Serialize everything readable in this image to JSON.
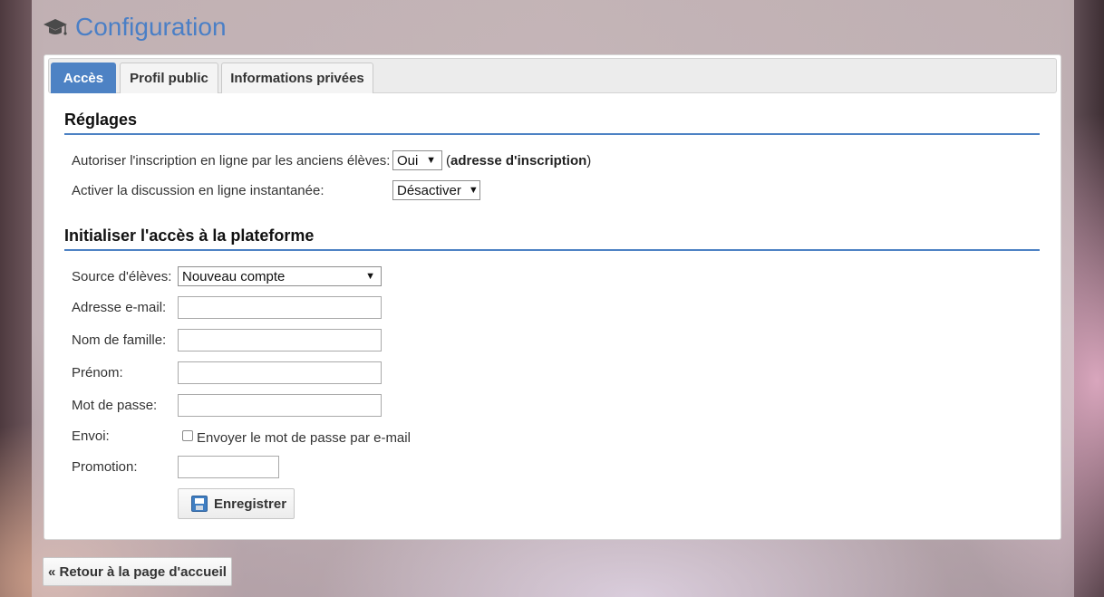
{
  "page": {
    "title": "Configuration"
  },
  "tabs": [
    {
      "label": "Accès",
      "active": true
    },
    {
      "label": "Profil public",
      "active": false
    },
    {
      "label": "Informations privées",
      "active": false
    }
  ],
  "settings": {
    "title": "Réglages",
    "online_registration": {
      "label": "Autoriser l'inscription en ligne par les anciens élèves:",
      "value": "Oui",
      "link_open": "(",
      "link_text": "adresse d'inscription",
      "link_close": ")"
    },
    "chat": {
      "label": "Activer la discussion en ligne instantanée:",
      "value": "Désactiver"
    }
  },
  "access": {
    "title": "Initialiser l'accès à la plateforme",
    "source": {
      "label": "Source d'élèves:",
      "value": "Nouveau compte"
    },
    "email": {
      "label": "Adresse e-mail:",
      "value": ""
    },
    "lastname": {
      "label": "Nom de famille:",
      "value": ""
    },
    "firstname": {
      "label": "Prénom:",
      "value": ""
    },
    "password": {
      "label": "Mot de passe:",
      "value": ""
    },
    "send": {
      "label": "Envoi:",
      "checkbox_label": "Envoyer le mot de passe par e-mail",
      "checked": false
    },
    "promotion": {
      "label": "Promotion:",
      "value": ""
    },
    "save_label": "Enregistrer"
  },
  "back_link": "« Retour à la page d'accueil",
  "colors": {
    "accent": "#4d82c4",
    "title": "#4a7fc6"
  }
}
